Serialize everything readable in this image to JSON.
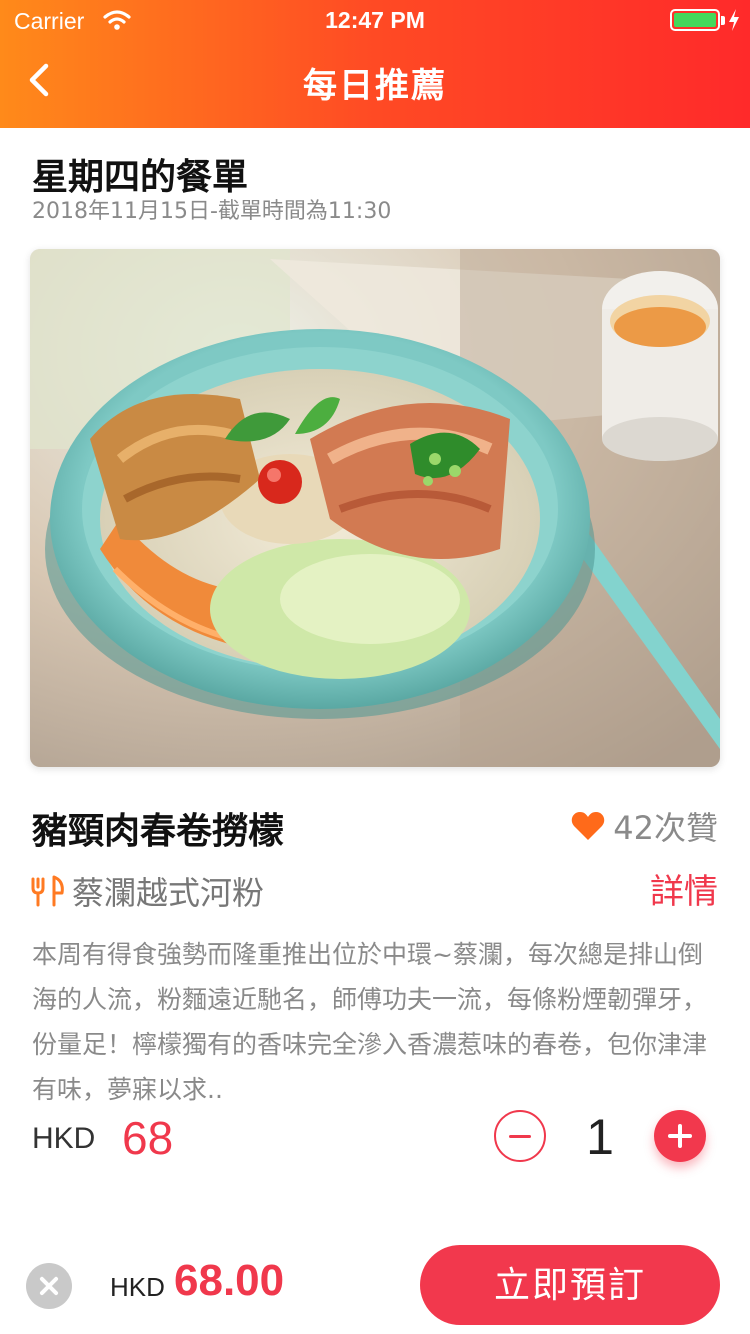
{
  "status_bar": {
    "carrier": "Carrier",
    "time": "12:47 PM",
    "battery_level": 1.0
  },
  "header": {
    "title": "每日推薦"
  },
  "menu": {
    "day_title": "星期四的餐單",
    "subtitle": "2018年11月15日-截單時間為11:30"
  },
  "dish": {
    "name": "豬頸肉春卷撈檬",
    "likes": "42次贊",
    "restaurant": "蔡瀾越式河粉",
    "details_label": "詳情",
    "description": "本周有得食強勢而隆重推出位於中環~蔡瀾，每次總是排山倒海的人流，粉麵遠近馳名，師傅功夫一流，每條粉煙韌彈牙，份量足！檸檬獨有的香味完全滲入香濃惹味的春卷，包你津津有味，夢寐以求..",
    "currency": "HKD",
    "price": "68",
    "quantity": "1"
  },
  "footer": {
    "currency": "HKD",
    "total": "68.00",
    "order_label": "立即預訂"
  },
  "colors": {
    "accent": "#f0384c",
    "header_start": "#ff8a1a",
    "header_end": "#ff2a2a",
    "heart": "#ff6a1a"
  },
  "icons": [
    "wifi-icon",
    "battery-icon",
    "back-chevron-icon",
    "heart-icon",
    "utensils-icon",
    "minus-icon",
    "plus-icon",
    "close-icon"
  ]
}
